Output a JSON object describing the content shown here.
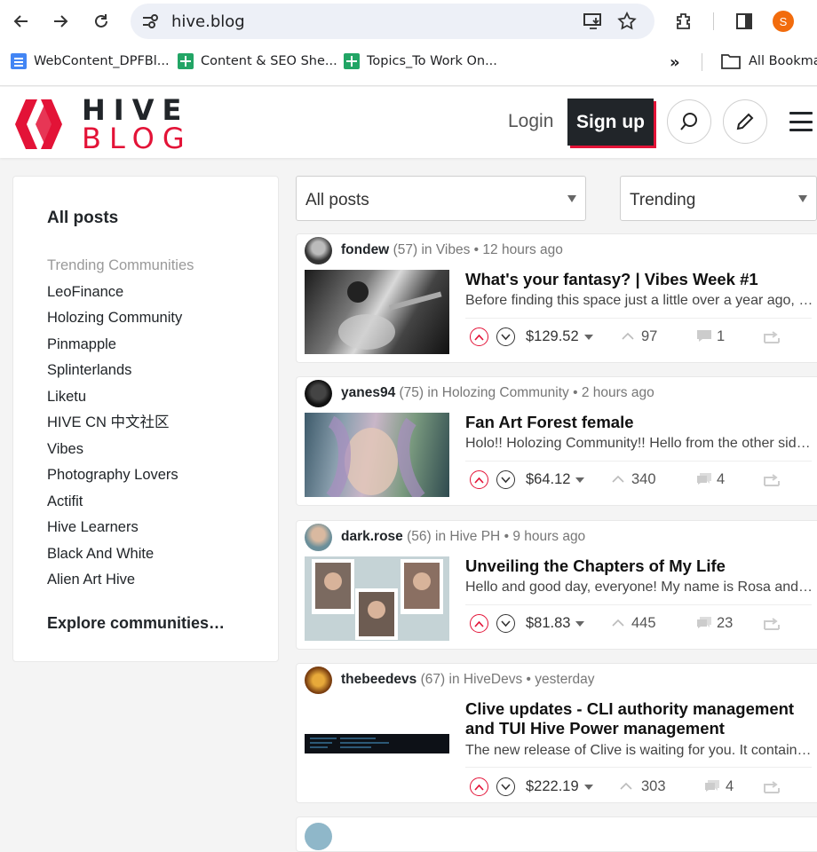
{
  "browser": {
    "url": "hive.blog",
    "profile_initial": "S",
    "bookmarks": [
      {
        "label": "WebContent_DPFBl...",
        "icon": "docs-icon"
      },
      {
        "label": "Content & SEO She...",
        "icon": "sheets-icon"
      },
      {
        "label": "Topics_To Work On...",
        "icon": "sheets-icon"
      }
    ],
    "all_bookmarks_label": "All Bookmarks"
  },
  "header": {
    "logo_top": "HIVE",
    "logo_bottom": "BLOG",
    "login_label": "Login",
    "signup_label": "Sign up"
  },
  "sidebar": {
    "title": "All posts",
    "section_label": "Trending Communities",
    "communities": [
      "LeoFinance",
      "Holozing Community",
      "Pinmapple",
      "Splinterlands",
      "Liketu",
      "HIVE CN 中文社区",
      "Vibes",
      "Photography Lovers",
      "Actifit",
      "Hive Learners",
      "Black And White",
      "Alien Art Hive"
    ],
    "explore_label": "Explore communities…"
  },
  "filters": {
    "feed": "All posts",
    "sort": "Trending"
  },
  "posts": [
    {
      "author": "fondew",
      "rep": "(57)",
      "in": "in",
      "community": "Vibes",
      "sep": "•",
      "time": "12 hours ago",
      "title": "What's your fantasy? | Vibes Week #1",
      "excerpt": "Before finding this space just a little over a year ago, I had no idea what to expect from the community...",
      "payout": "$129.52",
      "votes": "97",
      "comments": "1"
    },
    {
      "author": "yanes94",
      "rep": "(75)",
      "in": "in",
      "community": "Holozing Community",
      "sep": "•",
      "time": "2 hours ago",
      "title": "Fan Art Forest female",
      "excerpt": "Holo!! Holozing Community!! Hello from the other side of the forest...",
      "payout": "$64.12",
      "votes": "340",
      "comments": "4"
    },
    {
      "author": "dark.rose",
      "rep": "(56)",
      "in": "in",
      "community": "Hive PH",
      "sep": "•",
      "time": "9 hours ago",
      "title": "Unveiling the Chapters of My Life",
      "excerpt": "Hello and good day, everyone! My name is Rosa and this is my story...",
      "payout": "$81.83",
      "votes": "445",
      "comments": "23"
    },
    {
      "author": "thebeedevs",
      "rep": "(67)",
      "in": "in",
      "community": "HiveDevs",
      "sep": "•",
      "time": "yesterday",
      "title": "Clive updates - CLI authority management and TUI Hive Power management",
      "excerpt": "The new release of Clive is waiting for you. It contains many improvements...",
      "payout": "$222.19",
      "votes": "303",
      "comments": "4"
    }
  ]
}
